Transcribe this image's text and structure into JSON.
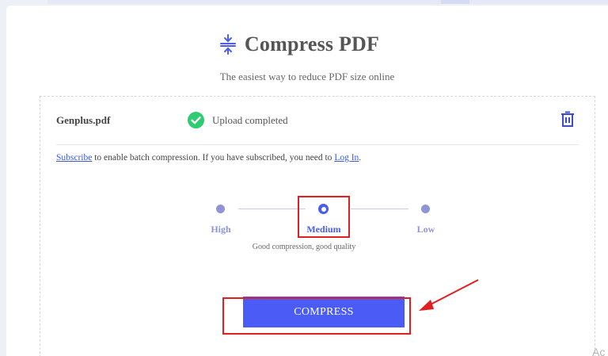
{
  "header": {
    "title": "Compress PDF",
    "subtitle": "The easiest way to reduce PDF size online"
  },
  "file": {
    "name": "Genplus.pdf",
    "status": "Upload completed"
  },
  "notice": {
    "subscribe_link": "Subscribe",
    "middle_text": " to enable batch compression. If you have subscribed, you need to ",
    "login_link": "Log In",
    "end_text": "."
  },
  "compression": {
    "levels": [
      "High",
      "Medium",
      "Low"
    ],
    "selected": "Medium",
    "hint": "Good compression, good quality"
  },
  "actions": {
    "compress_label": "COMPRESS"
  },
  "watermark": "Ac",
  "colors": {
    "accent": "#4a5cf5",
    "success": "#2ecc71",
    "annotation_red": "#e02020"
  }
}
